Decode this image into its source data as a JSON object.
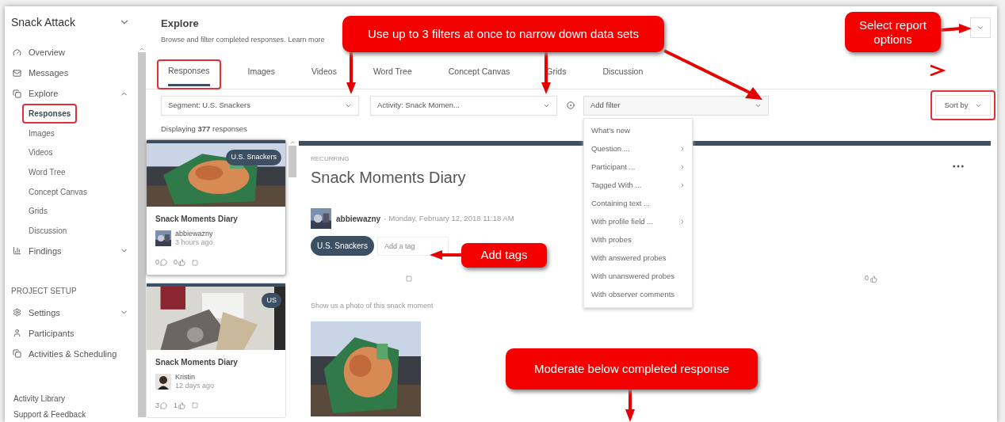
{
  "sidebar": {
    "project": "Snack Attack",
    "items": [
      {
        "kind": "link",
        "label": "Overview"
      },
      {
        "kind": "link",
        "label": "Messages"
      },
      {
        "kind": "group",
        "label": "Explore",
        "expanded": true,
        "children": [
          {
            "label": "Responses",
            "selected": true
          },
          {
            "label": "Images",
            "selected": false
          },
          {
            "label": "Videos",
            "selected": false
          },
          {
            "label": "Word Tree",
            "selected": false
          },
          {
            "label": "Concept Canvas",
            "selected": false
          },
          {
            "label": "Grids",
            "selected": false
          },
          {
            "label": "Discussion",
            "selected": false
          }
        ]
      },
      {
        "kind": "group",
        "label": "Findings",
        "expanded": false
      }
    ],
    "section": "PROJECT SETUP",
    "setup_items": [
      {
        "kind": "group",
        "label": "Settings",
        "expanded": false
      },
      {
        "kind": "link",
        "label": "Participants"
      },
      {
        "kind": "link",
        "label": "Activities & Scheduling"
      }
    ],
    "footer_links": [
      "Activity Library",
      "Support & Feedback"
    ]
  },
  "header": {
    "title": "Explore",
    "subtitle": "Browse and filter completed responses.",
    "link": "Learn more"
  },
  "tabs": [
    {
      "label": "Responses",
      "selected": true
    },
    {
      "label": "Images",
      "selected": false
    },
    {
      "label": "Videos",
      "selected": false
    },
    {
      "label": "Word Tree",
      "selected": false
    },
    {
      "label": "Concept Canvas",
      "selected": false
    },
    {
      "label": "Grids",
      "selected": false
    },
    {
      "label": "Discussion",
      "selected": false
    }
  ],
  "filters": [
    {
      "value": "Segment: U.S. Snackers"
    },
    {
      "value": "Activity: Snack Momen..."
    }
  ],
  "add_filter": {
    "placeholder": "Add filter",
    "menu": [
      {
        "label": "What's new",
        "submenu": false
      },
      {
        "label": "Question ...",
        "submenu": true
      },
      {
        "label": "Participant ...",
        "submenu": true
      },
      {
        "label": "Tagged With ...",
        "submenu": true
      },
      {
        "label": "Containing text ...",
        "submenu": false
      },
      {
        "label": "With profile field ...",
        "submenu": true
      },
      {
        "label": "With probes",
        "submenu": false
      },
      {
        "label": "With answered probes",
        "submenu": false
      },
      {
        "label": "With unanswered probes",
        "submenu": false
      },
      {
        "label": "With observer comments",
        "submenu": false
      }
    ]
  },
  "sort": {
    "label": "Sort by"
  },
  "count": "Displaying **377** responses",
  "cards": [
    {
      "title": "Snack Moments Diary",
      "tag": "U.S. Snackers",
      "author": "abbiewazny",
      "time": "3 hours ago",
      "comments": "0",
      "likes": "0",
      "selected": true
    },
    {
      "title": "Snack Moments Diary",
      "tag": "US",
      "author": "Kristin",
      "time": "12 days ago",
      "comments": "3",
      "likes": "1",
      "selected": false
    }
  ],
  "response": {
    "type_label": "RECURRING",
    "title": "Snack Moments Diary",
    "author": "abbiewazny",
    "separator": "·",
    "date": "Monday, February 12, 2018 11:18 AM",
    "tags": [
      "U.S. Snackers"
    ],
    "tag_placeholder": "Add a tag",
    "likes": "0",
    "question": "Show us a photo of this snack moment"
  },
  "callouts": [
    {
      "text": "Use up to 3 filters at once to narrow down data sets"
    },
    {
      "text": "Select report options"
    },
    {
      "text": "Add tags"
    },
    {
      "text": "Moderate below completed response"
    }
  ]
}
